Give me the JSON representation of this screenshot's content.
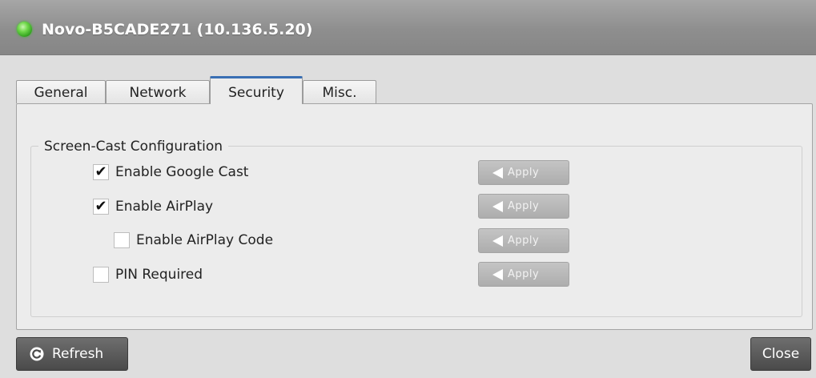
{
  "window": {
    "title": "Novo-B5CADE271 (10.136.5.20)",
    "status_color": "#3cb82a"
  },
  "tabs": [
    {
      "label": "General",
      "active": false
    },
    {
      "label": "Network",
      "active": false
    },
    {
      "label": "Security",
      "active": true
    },
    {
      "label": "Misc.",
      "active": false
    }
  ],
  "screen_cast": {
    "legend": "Screen-Cast Configuration",
    "options": [
      {
        "label": "Enable Google Cast",
        "checked": true,
        "apply_label": "Apply"
      },
      {
        "label": "Enable AirPlay",
        "checked": true,
        "apply_label": "Apply"
      },
      {
        "label": "Enable AirPlay Code",
        "checked": false,
        "apply_label": "Apply"
      },
      {
        "label": "PIN Required",
        "checked": false,
        "apply_label": "Apply"
      }
    ]
  },
  "footer": {
    "refresh_label": "Refresh",
    "close_label": "Close"
  },
  "colors": {
    "active_tab_accent": "#3a6fb4",
    "disabled_button": "#b8b8b8",
    "dark_button": "#555555"
  }
}
